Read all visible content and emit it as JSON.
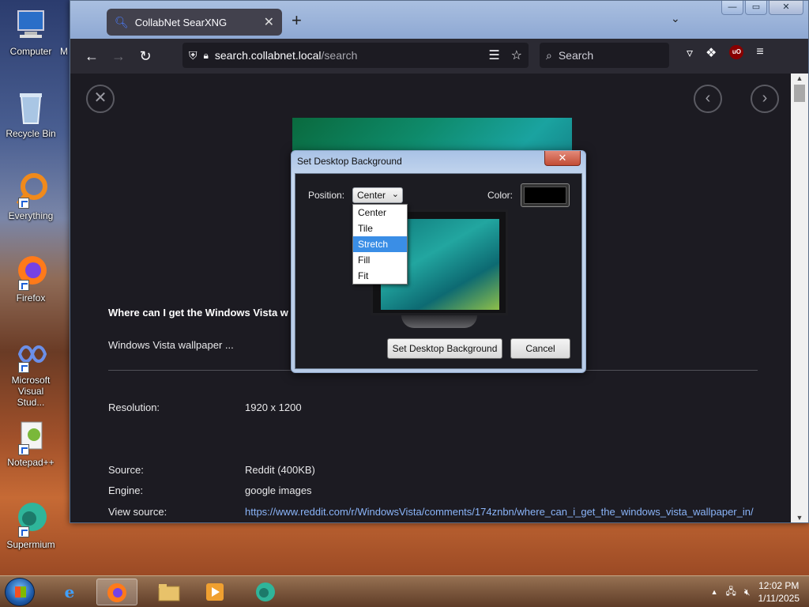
{
  "desktop": {
    "icons": [
      {
        "label": "Computer",
        "icon": "computer-icon"
      },
      {
        "label": "Recycle Bin",
        "icon": "recycle-bin-icon"
      },
      {
        "label": "Everything",
        "icon": "everything-icon"
      },
      {
        "label": "Firefox",
        "icon": "firefox-icon"
      },
      {
        "label": "Microsoft Visual Stud...",
        "icon": "visual-studio-icon"
      },
      {
        "label": "Notepad++",
        "icon": "notepadpp-icon"
      },
      {
        "label": "Supermium",
        "icon": "supermium-icon"
      }
    ],
    "partial_label": "M"
  },
  "browser": {
    "tab": {
      "title": "CollabNet SearXNG"
    },
    "new_tab": "+",
    "url": {
      "host": "search.collabnet.local",
      "path": "/search"
    },
    "search_placeholder": "Search"
  },
  "page": {
    "result_title": "Where can I get the Windows Vista w",
    "result_snippet": "Windows Vista wallpaper ...",
    "resolution_label": "Resolution:",
    "resolution_value": "1920 x 1200",
    "source_label": "Source:",
    "source_value": "Reddit (400KB)",
    "engine_label": "Engine:",
    "engine_value": "google images",
    "view_source_label": "View source:",
    "view_source_value": "https://www.reddit.com/r/WindowsVista/comments/174znbn/where_can_i_get_the_windows_vista_wallpaper_in/"
  },
  "dialog": {
    "title": "Set Desktop Background",
    "close": "✕",
    "position_label": "Position:",
    "position_value": "Center",
    "color_label": "Color:",
    "color_value": "#000000",
    "options": [
      "Center",
      "Tile",
      "Stretch",
      "Fill",
      "Fit"
    ],
    "highlighted_option": "Stretch",
    "set_button": "Set Desktop Background",
    "cancel_button": "Cancel"
  },
  "taskbar": {
    "time": "12:02 PM",
    "date": "1/11/2025"
  }
}
